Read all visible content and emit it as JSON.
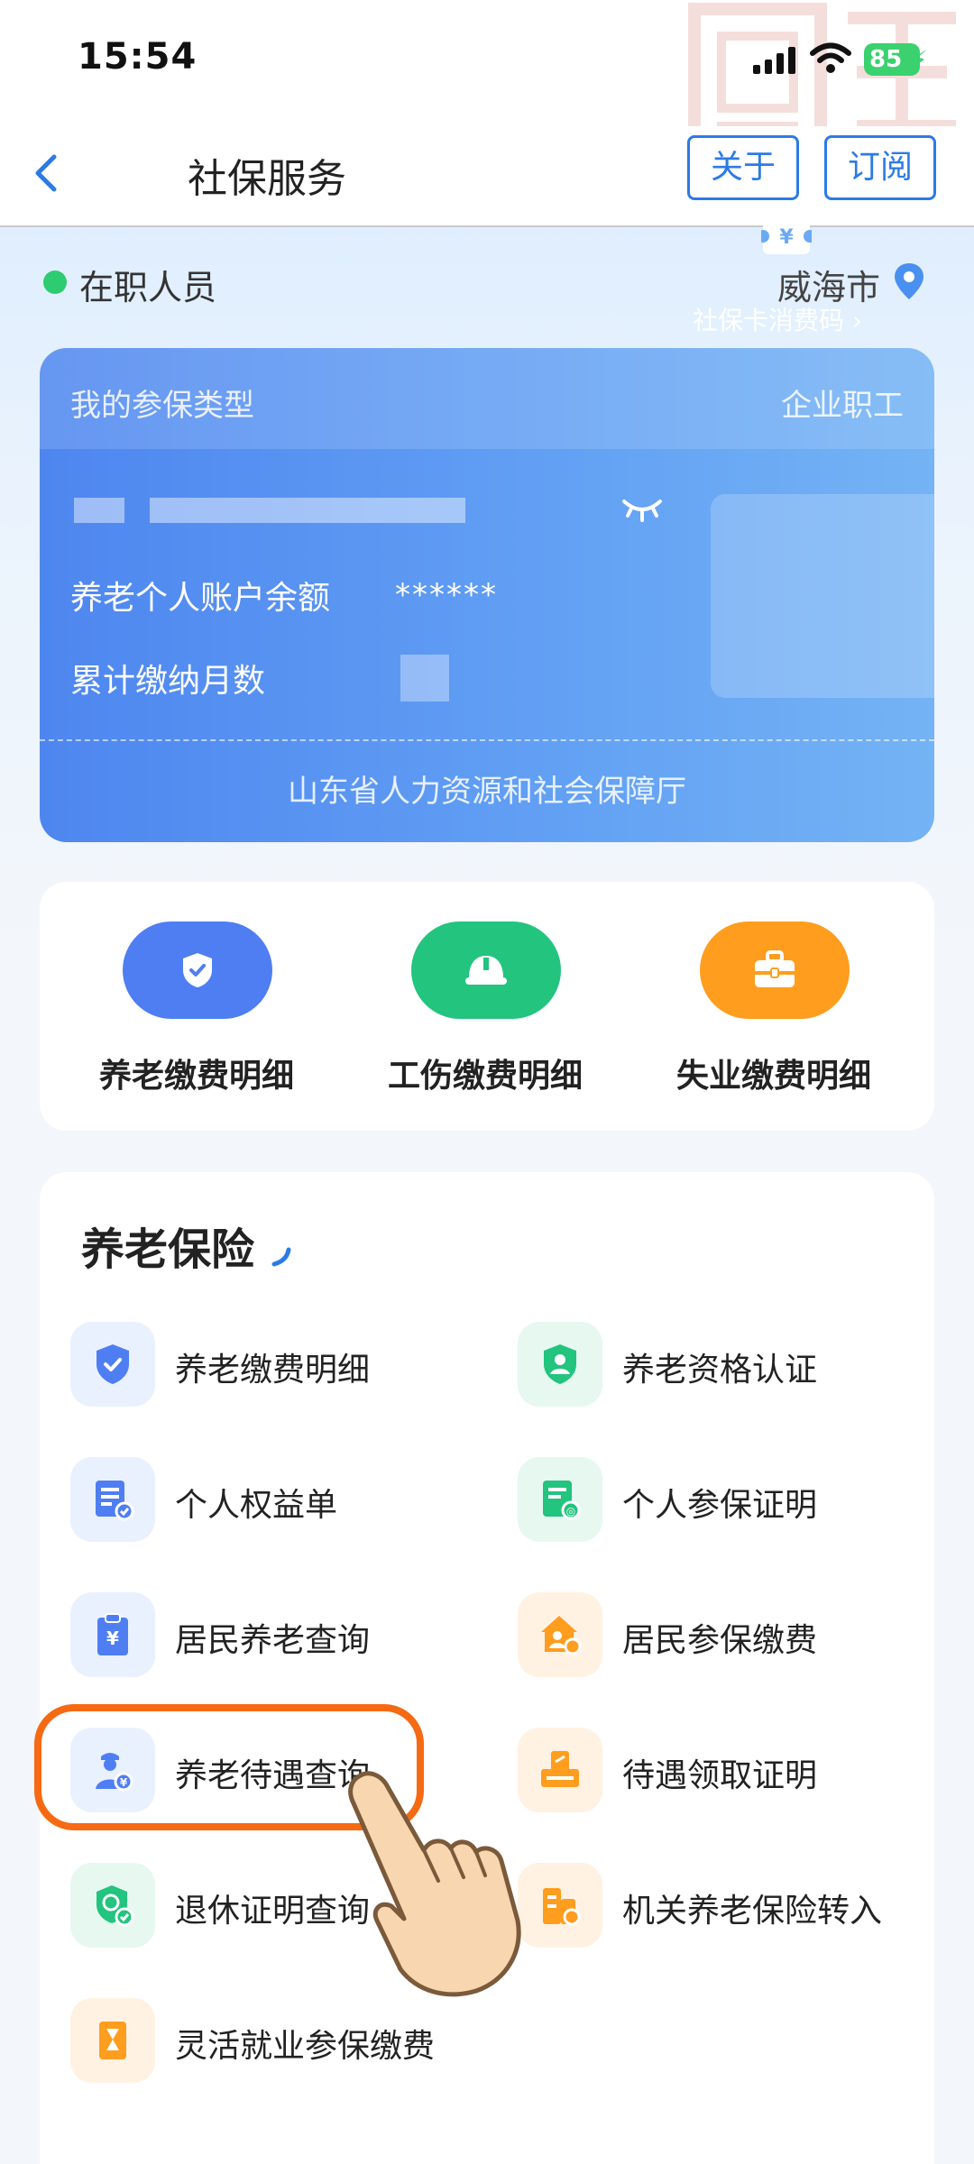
{
  "status_bar": {
    "time": "15:54",
    "battery": "85"
  },
  "nav": {
    "title": "社保服务",
    "about_label": "关于",
    "subscribe_label": "订阅"
  },
  "user": {
    "status": "在职人员",
    "city": "威海市"
  },
  "card": {
    "label": "我的参保类型",
    "type": "企业职工",
    "balance_label": "养老个人账户余额",
    "balance_value": "******",
    "months_label": "累计缴纳月数",
    "qr_label": "社保卡消费码 ›",
    "footer": "山东省人力资源和社会保障厅"
  },
  "quick_actions": [
    {
      "label": "养老缴费明细",
      "icon": "shield-check-icon",
      "color": "#4f7ef2"
    },
    {
      "label": "工伤缴费明细",
      "icon": "helmet-icon",
      "color": "#22c47e"
    },
    {
      "label": "失业缴费明细",
      "icon": "briefcase-icon",
      "color": "#ff9d1e"
    }
  ],
  "section": {
    "title": "养老保险",
    "items": [
      {
        "label": "养老缴费明细",
        "icon": "shield-check-icon"
      },
      {
        "label": "养老资格认证",
        "icon": "shield-person-icon"
      },
      {
        "label": "个人权益单",
        "icon": "document-list-icon"
      },
      {
        "label": "个人参保证明",
        "icon": "certificate-icon"
      },
      {
        "label": "居民养老查询",
        "icon": "clipboard-yuan-icon"
      },
      {
        "label": "居民参保缴费",
        "icon": "house-person-icon"
      },
      {
        "label": "养老待遇查询",
        "icon": "person-yuan-icon"
      },
      {
        "label": "待遇领取证明",
        "icon": "stamp-icon"
      },
      {
        "label": "退休证明查询",
        "icon": "shield-badge-icon"
      },
      {
        "label": "机关养老保险转入",
        "icon": "building-transfer-icon"
      },
      {
        "label": "灵活就业参保缴费",
        "icon": "hourglass-icon"
      }
    ]
  },
  "colors": {
    "accent": "#2c7be5",
    "highlight": "#f56a12"
  }
}
